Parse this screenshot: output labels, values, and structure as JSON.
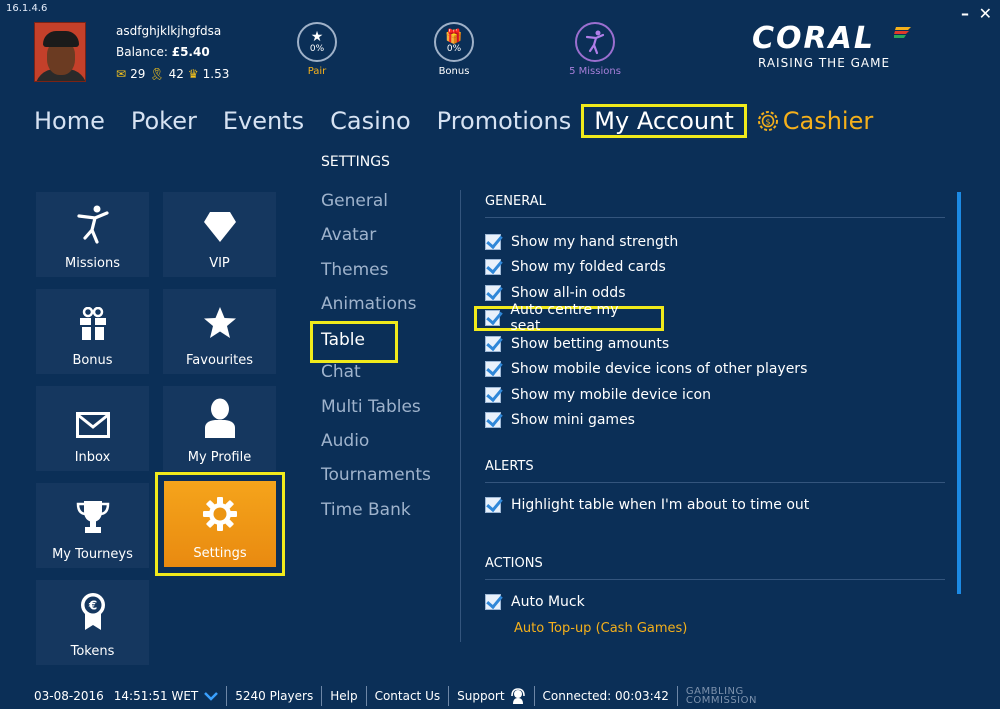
{
  "app": {
    "version": "16.1.4.6",
    "window_controls": "– ✕"
  },
  "user": {
    "name": "asdfghjklkjhgfdsa",
    "balance_label": "Balance:",
    "balance_value": "£5.40",
    "mail_count": "29",
    "award_count": "42",
    "crown_value": "1.53"
  },
  "stats": {
    "pair": {
      "percent": "0%",
      "label": "Pair"
    },
    "bonus": {
      "percent": "0%",
      "label": "Bonus"
    },
    "missions": {
      "label": "5 Missions"
    }
  },
  "brand": {
    "name": "CORAL",
    "tagline": "RAISING THE GAME",
    "flag_colors": [
      "#f5b01b",
      "#e03a2a",
      "#2aa85a"
    ]
  },
  "nav": {
    "items": [
      {
        "label": "Home"
      },
      {
        "label": "Poker"
      },
      {
        "label": "Events"
      },
      {
        "label": "Casino"
      },
      {
        "label": "Promotions"
      },
      {
        "label": "My Account"
      },
      {
        "label": "Cashier"
      }
    ]
  },
  "tiles": [
    {
      "label": "Missions",
      "icon": "dancer-icon"
    },
    {
      "label": "VIP",
      "icon": "diamond-icon"
    },
    {
      "label": "Bonus",
      "icon": "gift-icon"
    },
    {
      "label": "Favourites",
      "icon": "star-icon"
    },
    {
      "label": "Inbox",
      "icon": "mail-icon"
    },
    {
      "label": "My Profile",
      "icon": "person-icon"
    },
    {
      "label": "My Tourneys",
      "icon": "trophy-icon"
    },
    {
      "label": "Settings",
      "icon": "gear-icon"
    },
    {
      "label": "Tokens",
      "icon": "euro-medal-icon"
    }
  ],
  "settings_menu": {
    "title": "SETTINGS",
    "items": [
      {
        "label": "General"
      },
      {
        "label": "Avatar"
      },
      {
        "label": "Themes"
      },
      {
        "label": "Animations"
      },
      {
        "label": "Table"
      },
      {
        "label": "Chat"
      },
      {
        "label": "Multi Tables"
      },
      {
        "label": "Audio"
      },
      {
        "label": "Tournaments"
      },
      {
        "label": "Time Bank"
      }
    ]
  },
  "general": {
    "title": "GENERAL",
    "options": [
      {
        "label": "Show my hand strength",
        "checked": true
      },
      {
        "label": "Show my folded cards",
        "checked": true
      },
      {
        "label": "Show all-in odds",
        "checked": true
      },
      {
        "label": "Auto centre my seat",
        "checked": true
      },
      {
        "label": "Show betting amounts",
        "checked": true
      },
      {
        "label": "Show mobile device icons of other players",
        "checked": true
      },
      {
        "label": "Show my mobile device icon",
        "checked": true
      },
      {
        "label": "Show mini games",
        "checked": true
      }
    ]
  },
  "alerts": {
    "title": "ALERTS",
    "options": [
      {
        "label": "Highlight table when I'm about to time out",
        "checked": true
      }
    ]
  },
  "actions": {
    "title": "ACTIONS",
    "options": [
      {
        "label": "Auto Muck",
        "checked": true
      }
    ],
    "link": "Auto Top-up (Cash Games)"
  },
  "footer": {
    "date": "03-08-2016",
    "time": "14:51:51 WET",
    "players": "5240 Players",
    "help": "Help",
    "contact": "Contact Us",
    "support": "Support",
    "connected": "Connected: 00:03:42",
    "gambling_line1": "GAMBLING",
    "gambling_line2": "COMMISSION"
  },
  "colors": {
    "background": "#0b2f57",
    "tile": "#15375f",
    "accent_orange": "#f5a41b",
    "highlight_yellow": "#f1ea1b",
    "checkbox_blue": "#2f87d8",
    "scrollbar": "#1c8ae4"
  }
}
